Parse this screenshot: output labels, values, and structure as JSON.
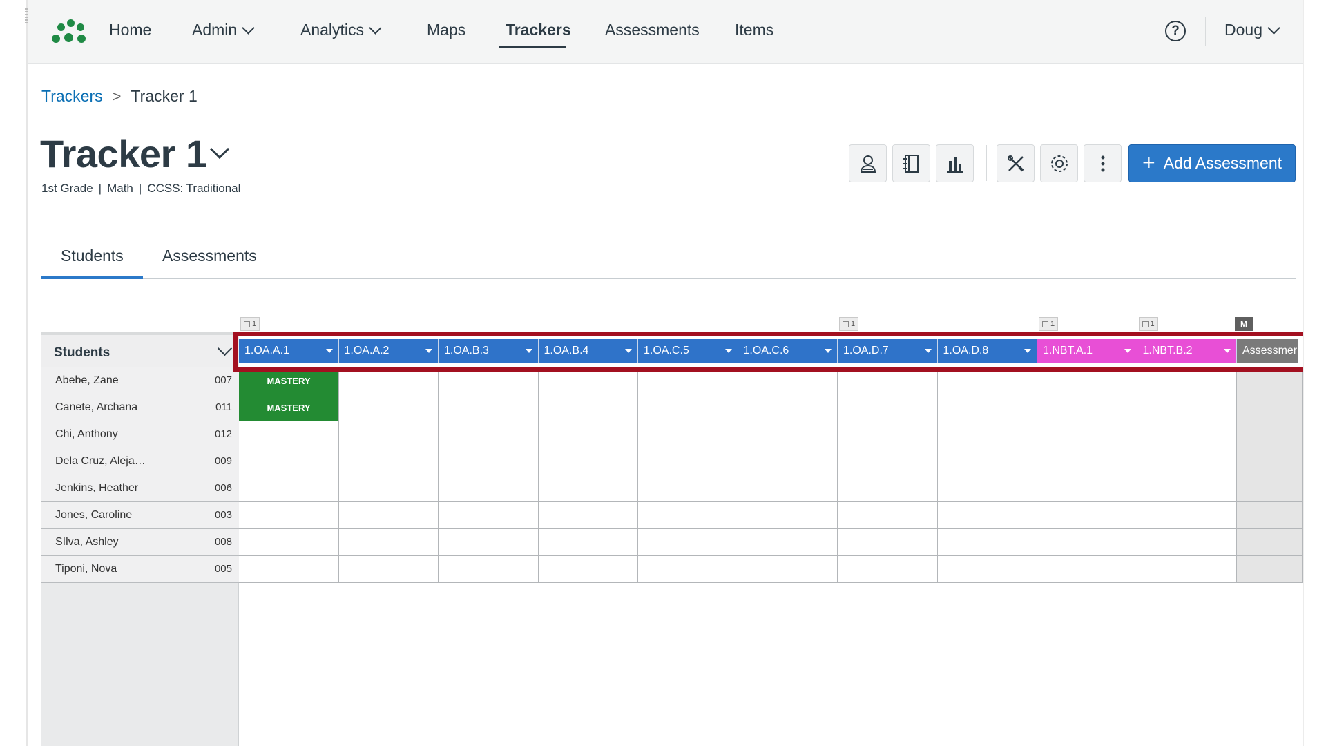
{
  "nav": {
    "items": [
      {
        "label": "Home",
        "has_menu": false
      },
      {
        "label": "Admin",
        "has_menu": true
      },
      {
        "label": "Analytics",
        "has_menu": true
      },
      {
        "label": "Maps",
        "has_menu": false
      },
      {
        "label": "Trackers",
        "has_menu": false,
        "active": true
      },
      {
        "label": "Assessments",
        "has_menu": false
      },
      {
        "label": "Items",
        "has_menu": false
      }
    ],
    "help_symbol": "?",
    "user_name": "Doug"
  },
  "breadcrumb": {
    "parent": "Trackers",
    "separator": ">",
    "current": "Tracker 1"
  },
  "page": {
    "title": "Tracker 1",
    "meta": [
      "1st Grade",
      "Math",
      "CCSS: Traditional"
    ],
    "meta_separator": "|",
    "add_assessment_label": "Add Assessment",
    "add_assessment_symbol": "+"
  },
  "toolbar_icons": [
    "student-icon",
    "notebook-icon",
    "bar-chart-icon",
    "tools-icon",
    "gear-icon",
    "more-vertical-icon"
  ],
  "tabs": [
    {
      "label": "Students",
      "active": true
    },
    {
      "label": "Assessments",
      "active": false
    }
  ],
  "grid": {
    "students_header": "Students",
    "columns": [
      {
        "code": "1.OA.A.1",
        "color": "#2f73c9",
        "count": "1"
      },
      {
        "code": "1.OA.A.2",
        "color": "#2f73c9"
      },
      {
        "code": "1.OA.B.3",
        "color": "#2f73c9"
      },
      {
        "code": "1.OA.B.4",
        "color": "#2f73c9"
      },
      {
        "code": "1.OA.C.5",
        "color": "#2f73c9"
      },
      {
        "code": "1.OA.C.6",
        "color": "#2f73c9"
      },
      {
        "code": "1.OA.D.7",
        "color": "#2f73c9",
        "count": "1"
      },
      {
        "code": "1.OA.D.8",
        "color": "#2f73c9"
      },
      {
        "code": "1.NBT.A.1",
        "color": "#e84fd6",
        "count": "1"
      },
      {
        "code": "1.NBT.B.2",
        "color": "#e84fd6",
        "count": "1"
      }
    ],
    "last_column": {
      "label": "Assessmer",
      "chip": "M"
    },
    "students": [
      {
        "name": "Abebe, Zane",
        "id": "007",
        "mastery_label": "MASTERY"
      },
      {
        "name": "Canete, Archana",
        "id": "011",
        "mastery_label": "MASTERY"
      },
      {
        "name": "Chi, Anthony",
        "id": "012"
      },
      {
        "name": "Dela Cruz, Aleja…",
        "id": "009"
      },
      {
        "name": "Jenkins, Heather",
        "id": "006"
      },
      {
        "name": "Jones, Caroline",
        "id": "003"
      },
      {
        "name": "SIlva, Ashley",
        "id": "008"
      },
      {
        "name": "Tiponi, Nova",
        "id": "005"
      }
    ],
    "mastery_color": "#238b33",
    "highlight_color": "#a31020"
  }
}
